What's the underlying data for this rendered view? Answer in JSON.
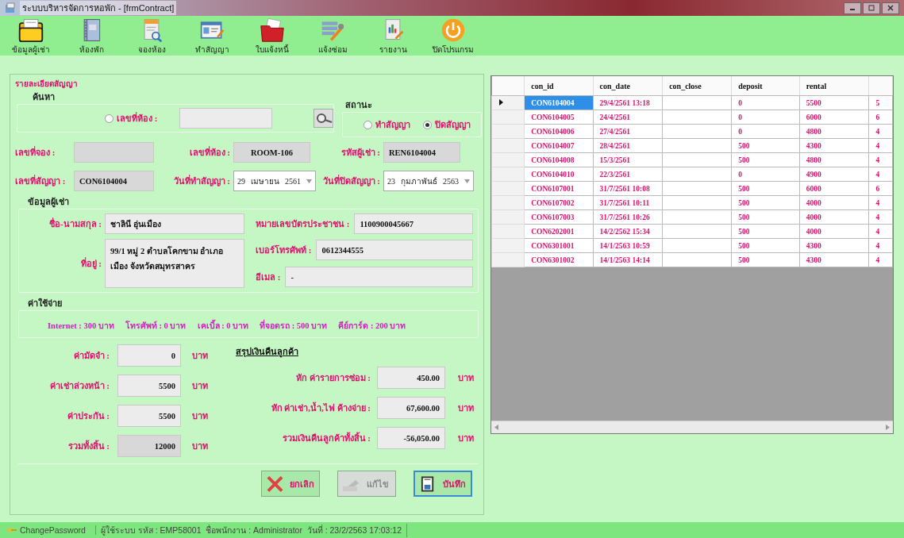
{
  "window": {
    "title": "ระบบบริหารจัดการหอพัก - [frmContract]"
  },
  "toolbar": [
    {
      "label": "ข้อมูลผู้เช่า",
      "kind": "folder"
    },
    {
      "label": "ห้องพัก",
      "kind": "binder"
    },
    {
      "label": "จองห้อง",
      "kind": "search-doc"
    },
    {
      "label": "ทำสัญญา",
      "kind": "card"
    },
    {
      "label": "ใบแจ้งหนี้",
      "kind": "red-folder"
    },
    {
      "label": "แจ้งซ่อม",
      "kind": "tools"
    },
    {
      "label": "รายงาน",
      "kind": "report"
    },
    {
      "label": "ปิดโปรแกรม",
      "kind": "power"
    }
  ],
  "form": {
    "title": "รายละเอียดสัญญา",
    "search": {
      "title": "ค้นหา",
      "option": {
        "label": "เลขที่ห้อง :",
        "selected": false
      }
    },
    "status": {
      "title": "สถานะ",
      "options": [
        {
          "label": "ทำสัญญา",
          "selected": false
        },
        {
          "label": "ปิดสัญญา",
          "selected": true
        }
      ]
    },
    "fields": [
      {
        "label": "เลขที่จอง :",
        "kind": "text",
        "disabled": true
      },
      {
        "label": "เลขที่ห้อง :",
        "value": "ROOM-106",
        "kind": "text",
        "disabled": true
      },
      {
        "label": "รหัสผู้เช่า :",
        "value": "REN6104004",
        "kind": "text",
        "disabled": true
      },
      {
        "label": "เลขที่สัญญา :",
        "value": "CON6104004",
        "kind": "text",
        "disabled": true
      },
      {
        "label": "วันที่ทำสัญญา :",
        "kind": "date",
        "day": "29",
        "month": "เมษายน",
        "year": "2561"
      },
      {
        "label": "วันที่ปิดสัญญา :",
        "kind": "date",
        "day": "23",
        "month": "กุมภาพันธ์",
        "year": "2563"
      }
    ],
    "tenant": {
      "title": "ข้อมูลผู้เช่า",
      "name": {
        "label": "ชื่อ-นามสกุล :",
        "value": "ชาลินี อุ่นเมือง"
      },
      "id_card": {
        "label": "หมายเลขบัตรประชาชน :",
        "value": "1100900045667"
      },
      "address": {
        "label": "ที่อยู่ :",
        "value": "99/1 หมู่ 2 ตำบลโคกขาม อำเภอเมือง จังหวัดสมุทรสาคร"
      },
      "phone": {
        "label": "เบอร์โทรศัพท์ :",
        "value": "0612344555"
      },
      "email": {
        "label": "อีเมล :",
        "value": "-"
      }
    },
    "expenses": {
      "title": "ค่าใช้จ่าย",
      "items": [
        "Internet : 300 บาท",
        "โทรศัพท์ : 0 บาท",
        "เคเบิ้ล : 0 บาท",
        "ที่จอดรถ : 500 บาท",
        "คีย์การ์ด : 200 บาท"
      ],
      "charges": [
        {
          "label": "ค่ามัดจำ :",
          "value": "0",
          "unit": "บาท",
          "disabled": false
        },
        {
          "label": "ค่าเช่าล่วงหน้า :",
          "value": "5500",
          "unit": "บาท",
          "disabled": false
        },
        {
          "label": "ค่าประกัน :",
          "value": "5500",
          "unit": "บาท",
          "disabled": false
        },
        {
          "label": "รวมทั้งสิ้น :",
          "value": "12000",
          "unit": "บาท",
          "disabled": true
        }
      ],
      "summary": {
        "title": "สรุปเงินคืนลูกค้า",
        "rows": [
          {
            "label": "หัก ค่ารายการซ่อม :",
            "value": "450.00",
            "unit": "บาท"
          },
          {
            "label": "หัก ค่าเช่า,น้ำ,ไฟ ค้างจ่าย :",
            "value": "67,600.00",
            "unit": "บาท"
          },
          {
            "label": "รวมเงินคืนลูกค้าทั้งสิ้น :",
            "value": "-56,050.00",
            "unit": "บาท"
          }
        ]
      }
    },
    "buttons": [
      {
        "label": "ยกเลิก",
        "kind": "cancel",
        "disabled": false,
        "focused": false
      },
      {
        "label": "แก้ไข",
        "kind": "edit",
        "disabled": true,
        "focused": false
      },
      {
        "label": "บันทึก",
        "kind": "save",
        "disabled": false,
        "focused": true
      }
    ]
  },
  "table": {
    "columns": [
      "con_id",
      "con_date",
      "con_close",
      "deposit",
      "rental"
    ],
    "rows": [
      {
        "cells": [
          "CON6104004",
          "29/4/2561 13:18",
          "",
          "0",
          "5500"
        ],
        "column_6": "5",
        "selected": true
      },
      {
        "cells": [
          "CON6104005",
          "24/4/2561",
          "",
          "0",
          "6000"
        ],
        "column_6": "6",
        "selected": false
      },
      {
        "cells": [
          "CON6104006",
          "27/4/2561",
          "",
          "0",
          "4800"
        ],
        "column_6": "4",
        "selected": false
      },
      {
        "cells": [
          "CON6104007",
          "28/4/2561",
          "",
          "500",
          "4300"
        ],
        "column_6": "4",
        "selected": false
      },
      {
        "cells": [
          "CON6104008",
          "15/3/2561",
          "",
          "500",
          "4800"
        ],
        "column_6": "4",
        "selected": false
      },
      {
        "cells": [
          "CON6104010",
          "22/3/2561",
          "",
          "0",
          "4900"
        ],
        "column_6": "4",
        "selected": false
      },
      {
        "cells": [
          "CON6107001",
          "31/7/2561 10:08",
          "",
          "500",
          "6000"
        ],
        "column_6": "6",
        "selected": false
      },
      {
        "cells": [
          "CON6107002",
          "31/7/2561 10:11",
          "",
          "500",
          "4000"
        ],
        "column_6": "4",
        "selected": false
      },
      {
        "cells": [
          "CON6107003",
          "31/7/2561 10:26",
          "",
          "500",
          "4000"
        ],
        "column_6": "4",
        "selected": false
      },
      {
        "cells": [
          "CON6202001",
          "14/2/2562 15:34",
          "",
          "500",
          "4000"
        ],
        "column_6": "4",
        "selected": false
      },
      {
        "cells": [
          "CON6301001",
          "14/1/2563 10:59",
          "",
          "500",
          "4300"
        ],
        "column_6": "4",
        "selected": false
      },
      {
        "cells": [
          "CON6301002",
          "14/1/2563 14:14",
          "",
          "500",
          "4300"
        ],
        "column_6": "4",
        "selected": false
      }
    ]
  },
  "status_bar": [
    {
      "text": "ChangePassword",
      "kind": "link"
    },
    {
      "text": "ผู้ใช้ระบบ รหัส : EMP58001  ชื่อพนักงาน : Administrator  วันที่ : 23/2/2563 17:03:12",
      "kind": "info"
    }
  ]
}
